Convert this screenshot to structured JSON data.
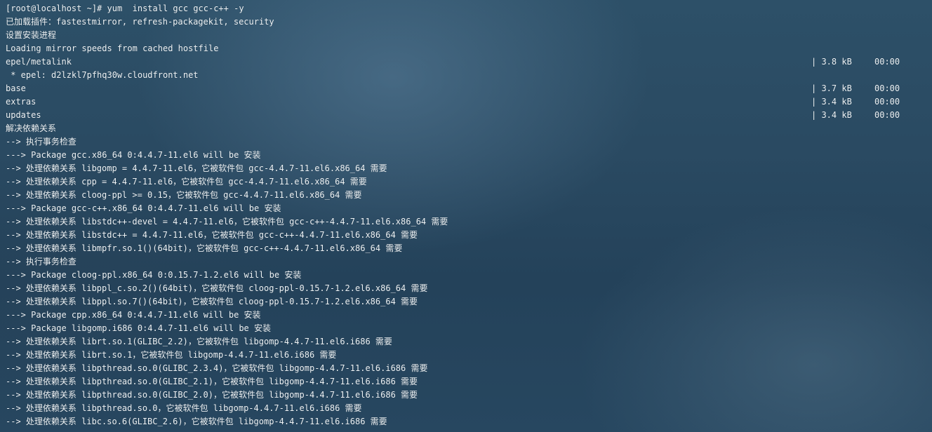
{
  "terminal": {
    "lines": [
      {
        "text": "[root@localhost ~]# yum  install gcc gcc-c++ -y",
        "size": "",
        "time": ""
      },
      {
        "text": "已加载插件：fastestmirror, refresh-packagekit, security",
        "size": "",
        "time": ""
      },
      {
        "text": "设置安装进程",
        "size": "",
        "time": ""
      },
      {
        "text": "Loading mirror speeds from cached hostfile",
        "size": "",
        "time": ""
      },
      {
        "text": "epel/metalink",
        "size": "| 3.8 kB",
        "time": "00:00"
      },
      {
        "text": " * epel: d2lzkl7pfhq30w.cloudfront.net",
        "size": "",
        "time": ""
      },
      {
        "text": "base",
        "size": "| 3.7 kB",
        "time": "00:00"
      },
      {
        "text": "extras",
        "size": "| 3.4 kB",
        "time": "00:00"
      },
      {
        "text": "updates",
        "size": "| 3.4 kB",
        "time": "00:00"
      },
      {
        "text": "解决依赖关系",
        "size": "",
        "time": ""
      },
      {
        "text": "--> 执行事务检查",
        "size": "",
        "time": ""
      },
      {
        "text": "---> Package gcc.x86_64 0:4.4.7-11.el6 will be 安装",
        "size": "",
        "time": ""
      },
      {
        "text": "--> 处理依赖关系 libgomp = 4.4.7-11.el6，它被软件包 gcc-4.4.7-11.el6.x86_64 需要",
        "size": "",
        "time": ""
      },
      {
        "text": "--> 处理依赖关系 cpp = 4.4.7-11.el6，它被软件包 gcc-4.4.7-11.el6.x86_64 需要",
        "size": "",
        "time": ""
      },
      {
        "text": "--> 处理依赖关系 cloog-ppl >= 0.15，它被软件包 gcc-4.4.7-11.el6.x86_64 需要",
        "size": "",
        "time": ""
      },
      {
        "text": "---> Package gcc-c++.x86_64 0:4.4.7-11.el6 will be 安装",
        "size": "",
        "time": ""
      },
      {
        "text": "--> 处理依赖关系 libstdc++-devel = 4.4.7-11.el6，它被软件包 gcc-c++-4.4.7-11.el6.x86_64 需要",
        "size": "",
        "time": ""
      },
      {
        "text": "--> 处理依赖关系 libstdc++ = 4.4.7-11.el6，它被软件包 gcc-c++-4.4.7-11.el6.x86_64 需要",
        "size": "",
        "time": ""
      },
      {
        "text": "--> 处理依赖关系 libmpfr.so.1()(64bit)，它被软件包 gcc-c++-4.4.7-11.el6.x86_64 需要",
        "size": "",
        "time": ""
      },
      {
        "text": "--> 执行事务检查",
        "size": "",
        "time": ""
      },
      {
        "text": "---> Package cloog-ppl.x86_64 0:0.15.7-1.2.el6 will be 安装",
        "size": "",
        "time": ""
      },
      {
        "text": "--> 处理依赖关系 libppl_c.so.2()(64bit)，它被软件包 cloog-ppl-0.15.7-1.2.el6.x86_64 需要",
        "size": "",
        "time": ""
      },
      {
        "text": "--> 处理依赖关系 libppl.so.7()(64bit)，它被软件包 cloog-ppl-0.15.7-1.2.el6.x86_64 需要",
        "size": "",
        "time": ""
      },
      {
        "text": "---> Package cpp.x86_64 0:4.4.7-11.el6 will be 安装",
        "size": "",
        "time": ""
      },
      {
        "text": "---> Package libgomp.i686 0:4.4.7-11.el6 will be 安装",
        "size": "",
        "time": ""
      },
      {
        "text": "--> 处理依赖关系 librt.so.1(GLIBC_2.2)，它被软件包 libgomp-4.4.7-11.el6.i686 需要",
        "size": "",
        "time": ""
      },
      {
        "text": "--> 处理依赖关系 librt.so.1，它被软件包 libgomp-4.4.7-11.el6.i686 需要",
        "size": "",
        "time": ""
      },
      {
        "text": "--> 处理依赖关系 libpthread.so.0(GLIBC_2.3.4)，它被软件包 libgomp-4.4.7-11.el6.i686 需要",
        "size": "",
        "time": ""
      },
      {
        "text": "--> 处理依赖关系 libpthread.so.0(GLIBC_2.1)，它被软件包 libgomp-4.4.7-11.el6.i686 需要",
        "size": "",
        "time": ""
      },
      {
        "text": "--> 处理依赖关系 libpthread.so.0(GLIBC_2.0)，它被软件包 libgomp-4.4.7-11.el6.i686 需要",
        "size": "",
        "time": ""
      },
      {
        "text": "--> 处理依赖关系 libpthread.so.0，它被软件包 libgomp-4.4.7-11.el6.i686 需要",
        "size": "",
        "time": ""
      },
      {
        "text": "--> 处理依赖关系 libc.so.6(GLIBC_2.6)，它被软件包 libgomp-4.4.7-11.el6.i686 需要",
        "size": "",
        "time": ""
      }
    ]
  }
}
